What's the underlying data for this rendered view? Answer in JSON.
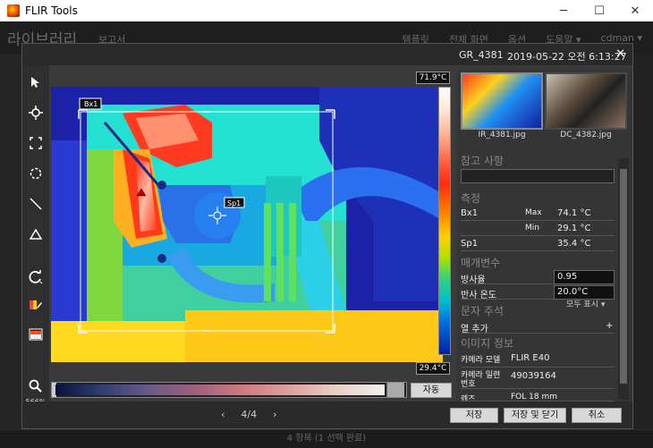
{
  "window": {
    "title": "FLIR Tools",
    "min": "─",
    "max": "☐",
    "close": "✕"
  },
  "appbar": {
    "library": "라이브러리",
    "report": "보고서",
    "menu": [
      "템플릿",
      "전체 화면",
      "옵션",
      "도움말 ▾",
      "cdman ▾"
    ]
  },
  "status": "4 항목 (1 선택 완료)",
  "dialog": {
    "filename": "GR_4381",
    "datetime": "2019-05-22 오전 6:13:27",
    "close": "✕",
    "zoom": "566%",
    "temp_max": "71.9°C",
    "temp_min": "29.4°C",
    "auto_button": "자동",
    "pager": {
      "prev": "‹",
      "page": "4/4",
      "next": "›"
    },
    "buttons": {
      "save": "저장",
      "save_close": "저장 및 닫기",
      "cancel": "취소"
    },
    "overlay": {
      "box": "Bx1",
      "spot": "Sp1"
    },
    "thumbs": [
      {
        "caption": "IR_4381.jpg"
      },
      {
        "caption": "DC_4382.jpg"
      }
    ]
  },
  "panel": {
    "notes_title": "참고 사항",
    "measure_title": "측정",
    "measurements": [
      {
        "name": "Bx1",
        "sub": "Max",
        "value": "74.1 °C"
      },
      {
        "name": "",
        "sub": "Min",
        "value": "29.1 °C"
      },
      {
        "name": "Sp1",
        "sub": "",
        "value": "35.4 °C"
      }
    ],
    "params_title": "매개변수",
    "params": [
      {
        "name": "방사율",
        "value": "0.95"
      },
      {
        "name": "반사 온도",
        "value": "20.0°C"
      }
    ],
    "show_all": "모두 표시 ▾",
    "text_title": "문자 주석",
    "add_col": "열 추가",
    "add_plus": "+",
    "info_title": "이미지 정보",
    "info": [
      {
        "name": "카메라 모델",
        "value": "FLIR E40"
      },
      {
        "name": "카메라 일련 번호",
        "value": "49039164"
      },
      {
        "name": "렌즈",
        "value": "FOL 18 mm"
      }
    ]
  },
  "colors": {
    "accent": "#3a6fd0",
    "dialog_bg": "#3a3a3a"
  }
}
